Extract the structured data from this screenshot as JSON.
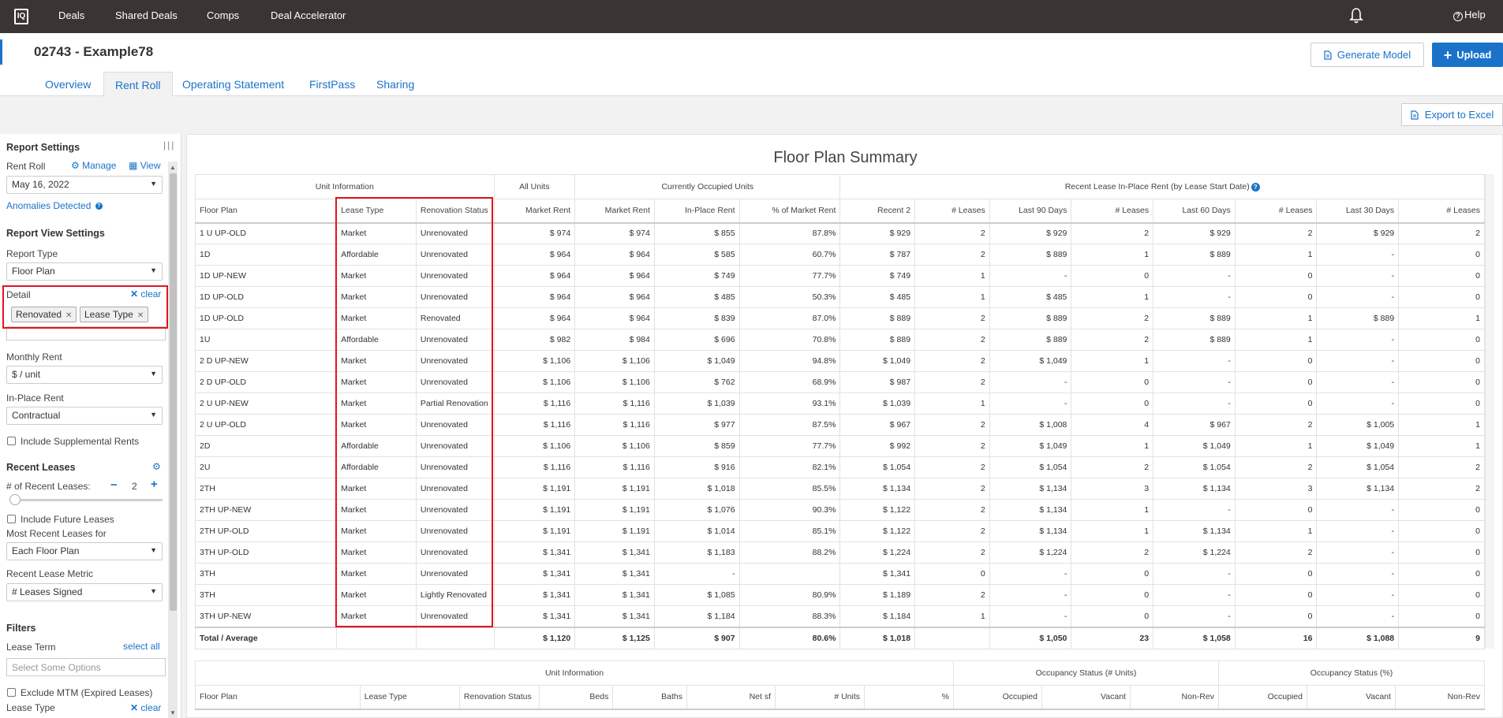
{
  "topnav": {
    "logo": "IQ",
    "items": [
      "Deals",
      "Shared Deals",
      "Comps",
      "Deal Accelerator"
    ],
    "help": "Help"
  },
  "header": {
    "title": "02743 - Example78",
    "generate_model": "Generate Model",
    "upload": "Upload",
    "tabs": [
      "Overview",
      "Rent Roll",
      "Operating Statement",
      "FirstPass",
      "Sharing"
    ],
    "active_tab": "Rent Roll",
    "export": "Export to Excel"
  },
  "sidebar": {
    "report_settings": "Report Settings",
    "rent_roll_label": "Rent Roll",
    "manage": "Manage",
    "view": "View",
    "rent_roll_date": "May 16, 2022",
    "anomalies": "Anomalies Detected",
    "report_view_settings": "Report View Settings",
    "report_type_label": "Report Type",
    "report_type": "Floor Plan",
    "detail_label": "Detail",
    "clear": "clear",
    "detail_tags": [
      "Renovated",
      "Lease Type"
    ],
    "monthly_rent_label": "Monthly Rent",
    "monthly_rent": "$ / unit",
    "inplace_rent_label": "In-Place Rent",
    "inplace_rent": "Contractual",
    "include_supplemental": "Include Supplemental Rents",
    "recent_leases": "Recent Leases",
    "num_recent_label": "# of Recent Leases:",
    "num_recent_minus": "−",
    "num_recent": "2",
    "num_recent_plus": "+",
    "include_future": "Include Future Leases",
    "most_recent_for_label": "Most Recent Leases for",
    "most_recent_for": "Each Floor Plan",
    "recent_metric_label": "Recent Lease Metric",
    "recent_metric": "# Leases Signed",
    "filters": "Filters",
    "lease_term_label": "Lease Term",
    "select_all": "select all",
    "lease_term_placeholder": "Select Some Options",
    "exclude_mtm": "Exclude MTM (Expired Leases)",
    "lease_type_label": "Lease Type",
    "clear2": "clear"
  },
  "summary": {
    "title": "Floor Plan Summary",
    "groups": [
      "Unit Information",
      "All Units",
      "Currently Occupied Units",
      "Recent Lease In-Place Rent (by Lease Start Date)"
    ],
    "columns": [
      "Floor Plan",
      "Lease Type",
      "Renovation Status",
      "Market Rent",
      "Market Rent",
      "In-Place Rent",
      "% of Market Rent",
      "Recent 2",
      "# Leases",
      "Last 90 Days",
      "# Leases",
      "Last 60 Days",
      "# Leases",
      "Last 30 Days",
      "# Leases"
    ],
    "rows": [
      [
        "1 U UP-OLD",
        "Market",
        "Unrenovated",
        "$ 974",
        "$ 974",
        "$ 855",
        "87.8%",
        "$ 929",
        "2",
        "$ 929",
        "2",
        "$ 929",
        "2",
        "$ 929",
        "2"
      ],
      [
        "1D",
        "Affordable",
        "Unrenovated",
        "$ 964",
        "$ 964",
        "$ 585",
        "60.7%",
        "$ 787",
        "2",
        "$ 889",
        "1",
        "$ 889",
        "1",
        "-",
        "0"
      ],
      [
        "1D UP-NEW",
        "Market",
        "Unrenovated",
        "$ 964",
        "$ 964",
        "$ 749",
        "77.7%",
        "$ 749",
        "1",
        "-",
        "0",
        "-",
        "0",
        "-",
        "0"
      ],
      [
        "1D UP-OLD",
        "Market",
        "Unrenovated",
        "$ 964",
        "$ 964",
        "$ 485",
        "50.3%",
        "$ 485",
        "1",
        "$ 485",
        "1",
        "-",
        "0",
        "-",
        "0"
      ],
      [
        "1D UP-OLD",
        "Market",
        "Renovated",
        "$ 964",
        "$ 964",
        "$ 839",
        "87.0%",
        "$ 889",
        "2",
        "$ 889",
        "2",
        "$ 889",
        "1",
        "$ 889",
        "1"
      ],
      [
        "1U",
        "Affordable",
        "Unrenovated",
        "$ 982",
        "$ 984",
        "$ 696",
        "70.8%",
        "$ 889",
        "2",
        "$ 889",
        "2",
        "$ 889",
        "1",
        "-",
        "0"
      ],
      [
        "2 D UP-NEW",
        "Market",
        "Unrenovated",
        "$ 1,106",
        "$ 1,106",
        "$ 1,049",
        "94.8%",
        "$ 1,049",
        "2",
        "$ 1,049",
        "1",
        "-",
        "0",
        "-",
        "0"
      ],
      [
        "2 D UP-OLD",
        "Market",
        "Unrenovated",
        "$ 1,106",
        "$ 1,106",
        "$ 762",
        "68.9%",
        "$ 987",
        "2",
        "-",
        "0",
        "-",
        "0",
        "-",
        "0"
      ],
      [
        "2 U UP-NEW",
        "Market",
        "Partial Renovation",
        "$ 1,116",
        "$ 1,116",
        "$ 1,039",
        "93.1%",
        "$ 1,039",
        "1",
        "-",
        "0",
        "-",
        "0",
        "-",
        "0"
      ],
      [
        "2 U UP-OLD",
        "Market",
        "Unrenovated",
        "$ 1,116",
        "$ 1,116",
        "$ 977",
        "87.5%",
        "$ 967",
        "2",
        "$ 1,008",
        "4",
        "$ 967",
        "2",
        "$ 1,005",
        "1"
      ],
      [
        "2D",
        "Affordable",
        "Unrenovated",
        "$ 1,106",
        "$ 1,106",
        "$ 859",
        "77.7%",
        "$ 992",
        "2",
        "$ 1,049",
        "1",
        "$ 1,049",
        "1",
        "$ 1,049",
        "1"
      ],
      [
        "2U",
        "Affordable",
        "Unrenovated",
        "$ 1,116",
        "$ 1,116",
        "$ 916",
        "82.1%",
        "$ 1,054",
        "2",
        "$ 1,054",
        "2",
        "$ 1,054",
        "2",
        "$ 1,054",
        "2"
      ],
      [
        "2TH",
        "Market",
        "Unrenovated",
        "$ 1,191",
        "$ 1,191",
        "$ 1,018",
        "85.5%",
        "$ 1,134",
        "2",
        "$ 1,134",
        "3",
        "$ 1,134",
        "3",
        "$ 1,134",
        "2"
      ],
      [
        "2TH UP-NEW",
        "Market",
        "Unrenovated",
        "$ 1,191",
        "$ 1,191",
        "$ 1,076",
        "90.3%",
        "$ 1,122",
        "2",
        "$ 1,134",
        "1",
        "-",
        "0",
        "-",
        "0"
      ],
      [
        "2TH UP-OLD",
        "Market",
        "Unrenovated",
        "$ 1,191",
        "$ 1,191",
        "$ 1,014",
        "85.1%",
        "$ 1,122",
        "2",
        "$ 1,134",
        "1",
        "$ 1,134",
        "1",
        "-",
        "0"
      ],
      [
        "3TH UP-OLD",
        "Market",
        "Unrenovated",
        "$ 1,341",
        "$ 1,341",
        "$ 1,183",
        "88.2%",
        "$ 1,224",
        "2",
        "$ 1,224",
        "2",
        "$ 1,224",
        "2",
        "-",
        "0"
      ],
      [
        "3TH",
        "Market",
        "Unrenovated",
        "$ 1,341",
        "$ 1,341",
        "-",
        "",
        "$ 1,341",
        "0",
        "-",
        "0",
        "-",
        "0",
        "-",
        "0"
      ],
      [
        "3TH",
        "Market",
        "Lightly Renovated",
        "$ 1,341",
        "$ 1,341",
        "$ 1,085",
        "80.9%",
        "$ 1,189",
        "2",
        "-",
        "0",
        "-",
        "0",
        "-",
        "0"
      ],
      [
        "3TH UP-NEW",
        "Market",
        "Unrenovated",
        "$ 1,341",
        "$ 1,341",
        "$ 1,184",
        "88.3%",
        "$ 1,184",
        "1",
        "-",
        "0",
        "-",
        "0",
        "-",
        "0"
      ]
    ],
    "total": [
      "Total / Average",
      "",
      "",
      "$ 1,120",
      "$ 1,125",
      "$ 907",
      "80.6%",
      "$ 1,018",
      "",
      "$ 1,050",
      "23",
      "$ 1,058",
      "16",
      "$ 1,088",
      "9"
    ]
  },
  "occupancy": {
    "groups": [
      "Unit Information",
      "Occupancy Status (# Units)",
      "Occupancy Status (%)"
    ],
    "columns": [
      "Floor Plan",
      "Lease Type",
      "Renovation Status",
      "Beds",
      "Baths",
      "Net sf",
      "# Units",
      "%",
      "Occupied",
      "Vacant",
      "Non-Rev",
      "Occupied",
      "Vacant",
      "Non-Rev"
    ]
  },
  "colors": {
    "nav_bg": "#3a3533",
    "accent": "#1a73c8",
    "highlight": "#e0161e"
  }
}
